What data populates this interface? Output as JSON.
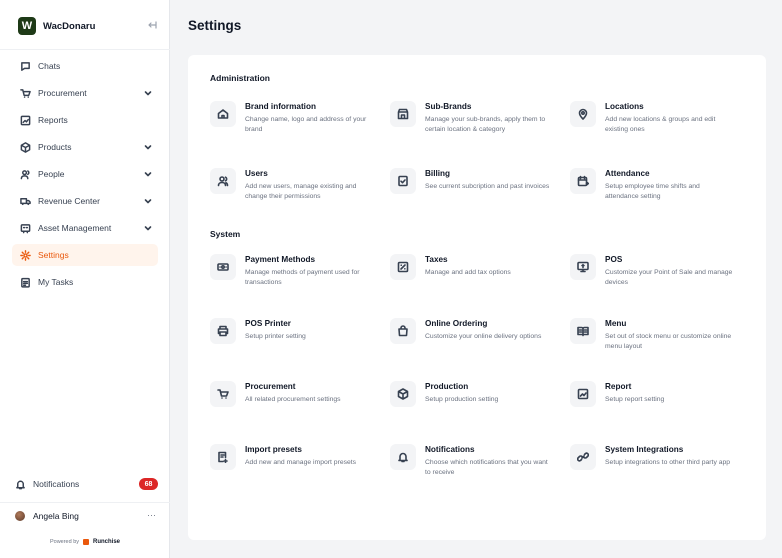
{
  "brand": {
    "logo_letter": "W",
    "name": "WacDonaru"
  },
  "sidebar": {
    "items": [
      {
        "label": "Chats",
        "icon": "chat-icon",
        "has_children": false,
        "active": false
      },
      {
        "label": "Procurement",
        "icon": "cart-icon",
        "has_children": true,
        "active": false
      },
      {
        "label": "Reports",
        "icon": "chart-icon",
        "has_children": false,
        "active": false
      },
      {
        "label": "Products",
        "icon": "box-icon",
        "has_children": true,
        "active": false
      },
      {
        "label": "People",
        "icon": "people-icon",
        "has_children": true,
        "active": false
      },
      {
        "label": "Revenue Center",
        "icon": "truck-icon",
        "has_children": true,
        "active": false
      },
      {
        "label": "Asset Management",
        "icon": "asset-icon",
        "has_children": true,
        "active": false
      },
      {
        "label": "Settings",
        "icon": "gear-icon",
        "has_children": false,
        "active": true
      },
      {
        "label": "My Tasks",
        "icon": "clipboard-icon",
        "has_children": false,
        "active": false
      }
    ],
    "notifications": {
      "label": "Notifications",
      "count": "68"
    },
    "user": {
      "name": "Angela Bing",
      "more": "···"
    },
    "powered_by": {
      "prefix": "Powered by",
      "name": "Runchise"
    }
  },
  "page": {
    "title": "Settings"
  },
  "sections": [
    {
      "title": "Administration",
      "tiles": [
        {
          "title": "Brand information",
          "desc": "Change name, logo and address of your brand",
          "icon": "home-icon"
        },
        {
          "title": "Sub-Brands",
          "desc": "Manage your sub-brands, apply them to certain location & category",
          "icon": "store-icon"
        },
        {
          "title": "Locations",
          "desc": "Add new locations & groups and edit existing ones",
          "icon": "location-pin-icon"
        },
        {
          "title": "Users",
          "desc": "Add new users, manage existing and change their permissions",
          "icon": "users-icon"
        },
        {
          "title": "Billing",
          "desc": "See current subcription and past invoices",
          "icon": "billing-icon"
        },
        {
          "title": "Attendance",
          "desc": "Setup employee time shifts and attendance setting",
          "icon": "calendar-icon"
        }
      ]
    },
    {
      "title": "System",
      "tiles": [
        {
          "title": "Payment Methods",
          "desc": "Manage methods of payment used for transactions",
          "icon": "payment-icon"
        },
        {
          "title": "Taxes",
          "desc": "Manage and add tax options",
          "icon": "tax-icon"
        },
        {
          "title": "POS",
          "desc": "Customize your Point of Sale and manage devices",
          "icon": "monitor-icon"
        },
        {
          "title": "POS Printer",
          "desc": "Setup printer setting",
          "icon": "printer-icon"
        },
        {
          "title": "Online Ordering",
          "desc": "Customize your online delivery options",
          "icon": "bag-icon"
        },
        {
          "title": "Menu",
          "desc": "Set out of stock menu or customize online menu layout",
          "icon": "menu-book-icon"
        },
        {
          "title": "Procurement",
          "desc": "All related procurement settings",
          "icon": "cart-icon"
        },
        {
          "title": "Production",
          "desc": "Setup production setting",
          "icon": "production-icon"
        },
        {
          "title": "Report",
          "desc": "Setup report setting",
          "icon": "report-icon"
        },
        {
          "title": "Import presets",
          "desc": "Add new and manage import presets",
          "icon": "import-icon"
        },
        {
          "title": "Notifications",
          "desc": "Choose which notifications that you want to receive",
          "icon": "bell-icon"
        },
        {
          "title": "System Integrations",
          "desc": "Setup integrations to other third party app",
          "icon": "link-icon"
        }
      ]
    }
  ],
  "colors": {
    "accent": "#ea580c",
    "brand_logo": "#1e3a17",
    "badge": "#dc2626"
  }
}
